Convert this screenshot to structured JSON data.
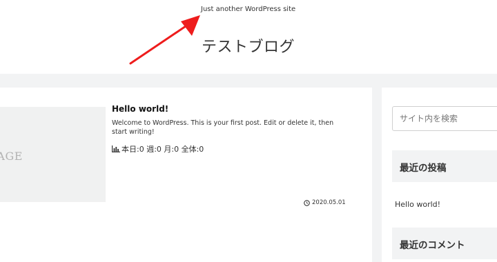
{
  "header": {
    "tagline": "Just another WordPress site",
    "site_title": "テストブログ"
  },
  "post": {
    "thumbnail_text": "NO IMAGE",
    "title": "Hello world!",
    "excerpt": "Welcome to WordPress. This is your first post. Edit or delete it, then start writing!",
    "views": "本日:0 週:0 月:0 全体:0",
    "views_icon": "bar-chart-icon",
    "date": "2020.05.01",
    "date_icon": "clock-icon"
  },
  "sidebar": {
    "search_placeholder": "サイト内を検索",
    "recent_posts_heading": "最近の投稿",
    "recent_posts": [
      "Hello world!"
    ],
    "recent_comments_heading": "最近のコメント"
  },
  "annotation": {
    "arrow_color": "#ee1c1c"
  },
  "colors": {
    "background": "#f2f3f4",
    "card": "#ffffff",
    "text": "#333333"
  }
}
